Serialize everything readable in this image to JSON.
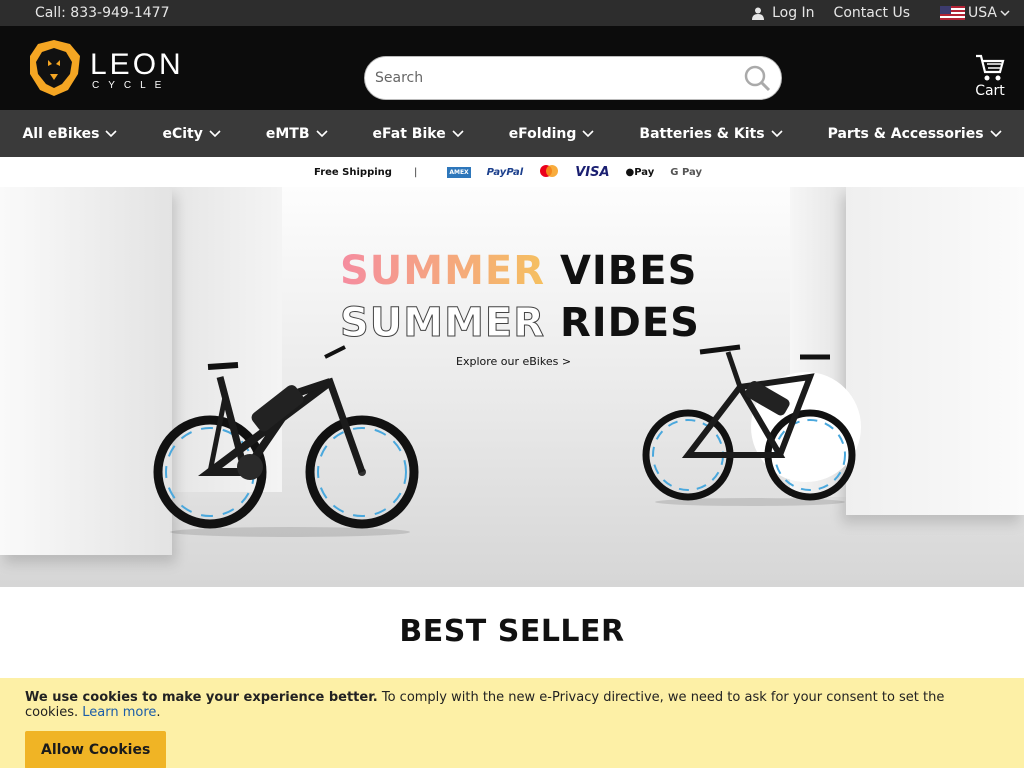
{
  "topbar": {
    "phone": "Call: 833-949-1477",
    "login": "Log In",
    "contact": "Contact Us",
    "country": "USA"
  },
  "header": {
    "logo_text": "LEON",
    "logo_sub": "CYCLE",
    "search_placeholder": "Search",
    "cart_label": "Cart"
  },
  "nav": {
    "items": [
      "All eBikes",
      "eCity",
      "eMTB",
      "eFat Bike",
      "eFolding",
      "Batteries & Kits",
      "Parts & Accessories"
    ]
  },
  "payments": {
    "free_shipping": "Free Shipping",
    "separator": "|",
    "methods": [
      "AMEX",
      "PayPal",
      "",
      "VISA",
      "Pay",
      "G Pay"
    ]
  },
  "hero": {
    "line1_a": "SUMMER",
    "line1_b": "VIBES",
    "line2_a": "SUMMER",
    "line2_b": "RIDES",
    "cta": "Explore our eBikes >"
  },
  "section": {
    "title": "BEST SELLER"
  },
  "cookie": {
    "bold": "We use cookies to make your experience better.",
    "text": " To comply with the new e-Privacy directive, we need to ask for your consent to set the cookies. ",
    "link": "Learn more",
    "after": ".",
    "button": "Allow Cookies"
  },
  "colors": {
    "topbar": "#2d2d2d",
    "header": "#0c0c0c",
    "nav": "#3a3a3a",
    "brand_orange": "#f5a623",
    "cookie_bg": "#fdf0a6",
    "cookie_button": "#f0b425"
  }
}
